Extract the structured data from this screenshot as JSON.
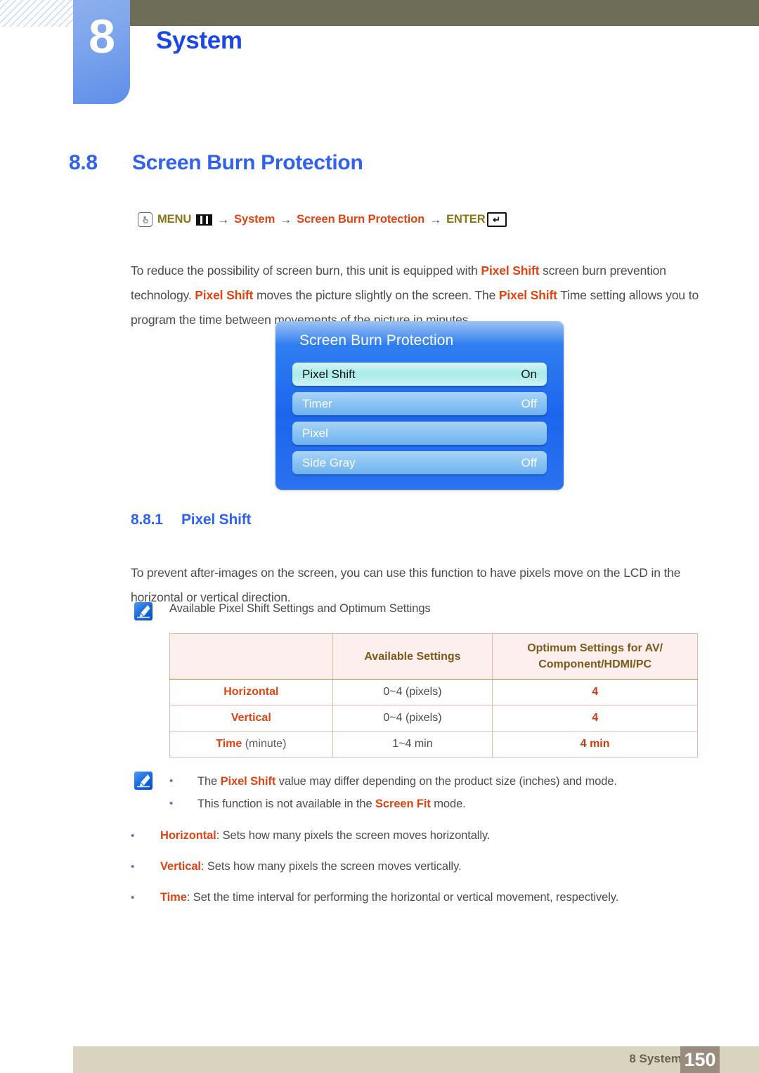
{
  "header": {
    "chapter_number": "8",
    "chapter_title": "System"
  },
  "section": {
    "number": "8.8",
    "title": "Screen Burn Protection"
  },
  "breadcrumb": {
    "hand_icon": "hand-pointer-icon",
    "menu_label": "MENU",
    "menu_icon": "menu-bars-icon",
    "arrow1": "→",
    "path1": "System",
    "arrow2": "→",
    "path2": "Screen Burn Protection",
    "arrow3": "→",
    "enter_label": "ENTER",
    "enter_icon": "enter-return-icon"
  },
  "intro_paragraph": {
    "t1": "To reduce the possibility of screen burn, this unit is equipped with ",
    "b1": "Pixel Shift",
    "t2": " screen burn prevention technology. ",
    "b2": "Pixel Shift",
    "t3": " moves the picture slightly on the screen. The ",
    "b3": "Pixel Shift",
    "t4": " Time setting allows you to program the time between movements of the picture in minutes."
  },
  "osd": {
    "title": "Screen Burn Protection",
    "rows": [
      {
        "label": "Pixel Shift",
        "value": "On",
        "selected": true
      },
      {
        "label": "Timer",
        "value": "Off",
        "selected": false
      },
      {
        "label": "Pixel",
        "value": "",
        "selected": false
      },
      {
        "label": "Side Gray",
        "value": "Off",
        "selected": false
      }
    ]
  },
  "subsection": {
    "number": "8.8.1",
    "title": "Pixel Shift"
  },
  "pixelshift_paragraph": {
    "text": "To prevent after-images on the screen, you can use this function to have pixels move on the LCD in the horizontal or vertical direction."
  },
  "note_icon_label": "Available Pixel Shift Settings and Optimum Settings",
  "table": {
    "headers": [
      "",
      "Available Settings",
      "Optimum Settings for AV/\nComponent/HDMI/PC"
    ],
    "header_col2": "Available Settings",
    "header_col3_line1": "Optimum Settings for AV/",
    "header_col3_line2": "Component/HDMI/PC",
    "rows": [
      {
        "label": "Horizontal",
        "label_suffix": "",
        "available": "0~4 (pixels)",
        "optimum": "4"
      },
      {
        "label": "Vertical",
        "label_suffix": "",
        "available": "0~4 (pixels)",
        "optimum": "4"
      },
      {
        "label": "Time",
        "label_suffix": " (minute)",
        "available": "1~4 min",
        "optimum": "4 min"
      }
    ]
  },
  "notes": [
    {
      "t1": "The ",
      "b1": "Pixel Shift",
      "t2": " value may differ depending on the product size (inches) and mode."
    },
    {
      "t1": "This function is not available in the ",
      "b1": "Screen Fit",
      "t2": " mode."
    }
  ],
  "definitions": [
    {
      "term": "Horizontal",
      "desc": ": Sets how many pixels the screen moves horizontally."
    },
    {
      "term": "Vertical",
      "desc": ": Sets how many pixels the screen moves vertically."
    },
    {
      "term": "Time",
      "desc": ": Set the time interval for performing the horizontal or vertical movement, respectively."
    }
  ],
  "footer": {
    "label": "8 System",
    "page_number": "150"
  },
  "colors": {
    "chapter_blue": "#7ba3ec",
    "heading_blue": "#2f62f0",
    "accent_red": "#e24310",
    "olive": "#8a7413",
    "topbar": "#6d6d58",
    "footer_bar": "#d8d4c0",
    "footer_page": "#9a8d7f",
    "table_header_bg": "#fcefee",
    "table_border": "#9a7b2e"
  }
}
